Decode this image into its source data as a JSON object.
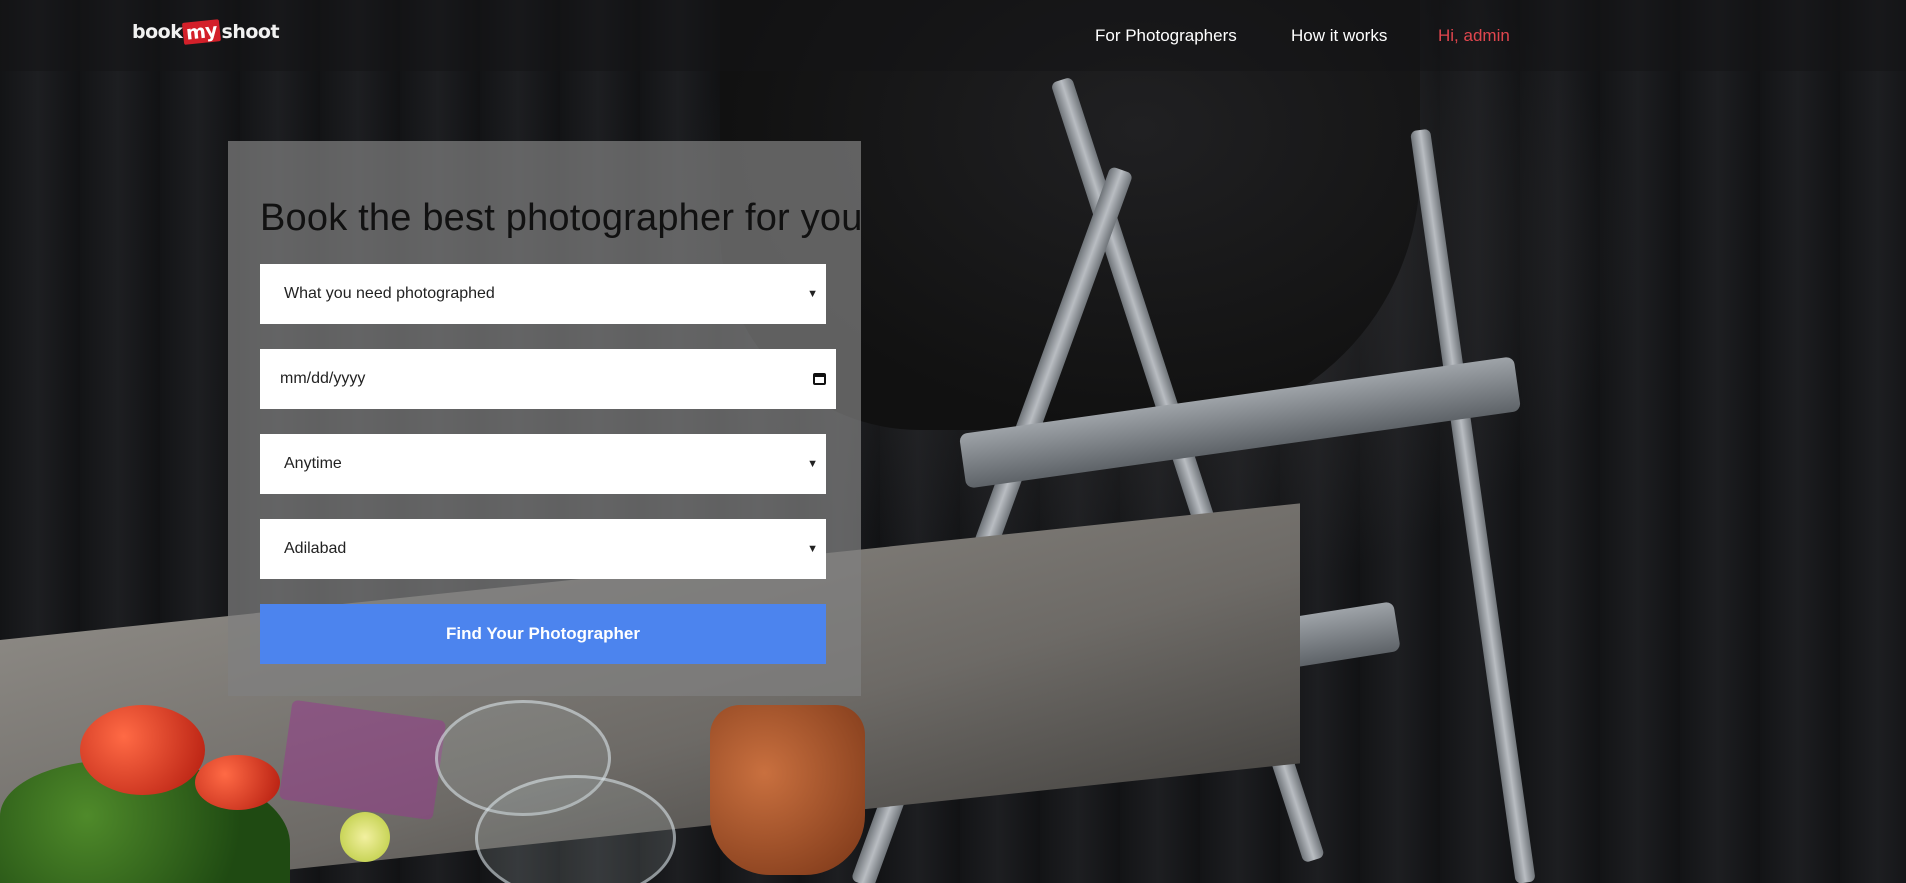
{
  "brand": {
    "logo_part1": "book",
    "logo_part2": "my",
    "logo_part3": "shoot",
    "accent_color": "#d3202a"
  },
  "nav": {
    "items": [
      {
        "label": "For Photographers"
      },
      {
        "label": "How it works"
      },
      {
        "label": "Hi, admin",
        "color": "#e0464e"
      }
    ]
  },
  "search_form": {
    "title": "Book the best photographer for you",
    "category_select": {
      "value": "What you need photographed"
    },
    "date_input": {
      "placeholder": "mm/dd/yyyy",
      "icon": "calendar-icon"
    },
    "time_select": {
      "value": "Anytime"
    },
    "city_select": {
      "value": "Adilabad"
    },
    "submit_label": "Find Your Photographer",
    "button_color": "#4c84ee"
  }
}
